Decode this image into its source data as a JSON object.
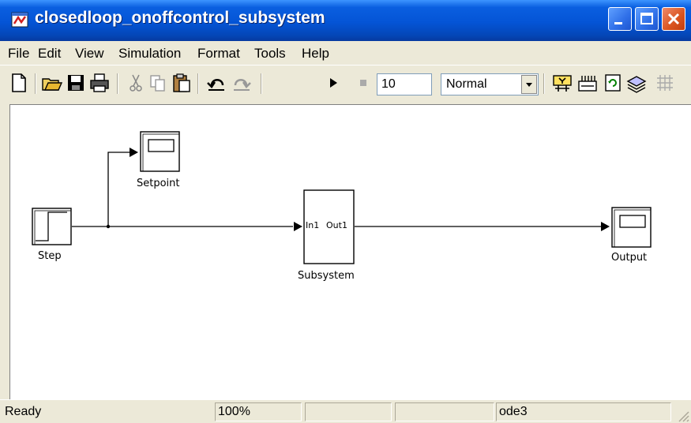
{
  "window": {
    "title": "closedloop_onoffcontrol_subsystem"
  },
  "menu": [
    "File",
    "Edit",
    "View",
    "Simulation",
    "Format",
    "Tools",
    "Help"
  ],
  "toolbar": {
    "stop_time": "10",
    "sim_mode": "Normal"
  },
  "diagram": {
    "blocks": {
      "step": "Step",
      "setpoint": "Setpoint",
      "subsystem": "Subsystem",
      "subsystem_in": "In1",
      "subsystem_out": "Out1",
      "output": "Output"
    }
  },
  "status": {
    "state": "Ready",
    "zoom": "100%",
    "cell3": "",
    "cell4": "",
    "solver": "ode3"
  }
}
